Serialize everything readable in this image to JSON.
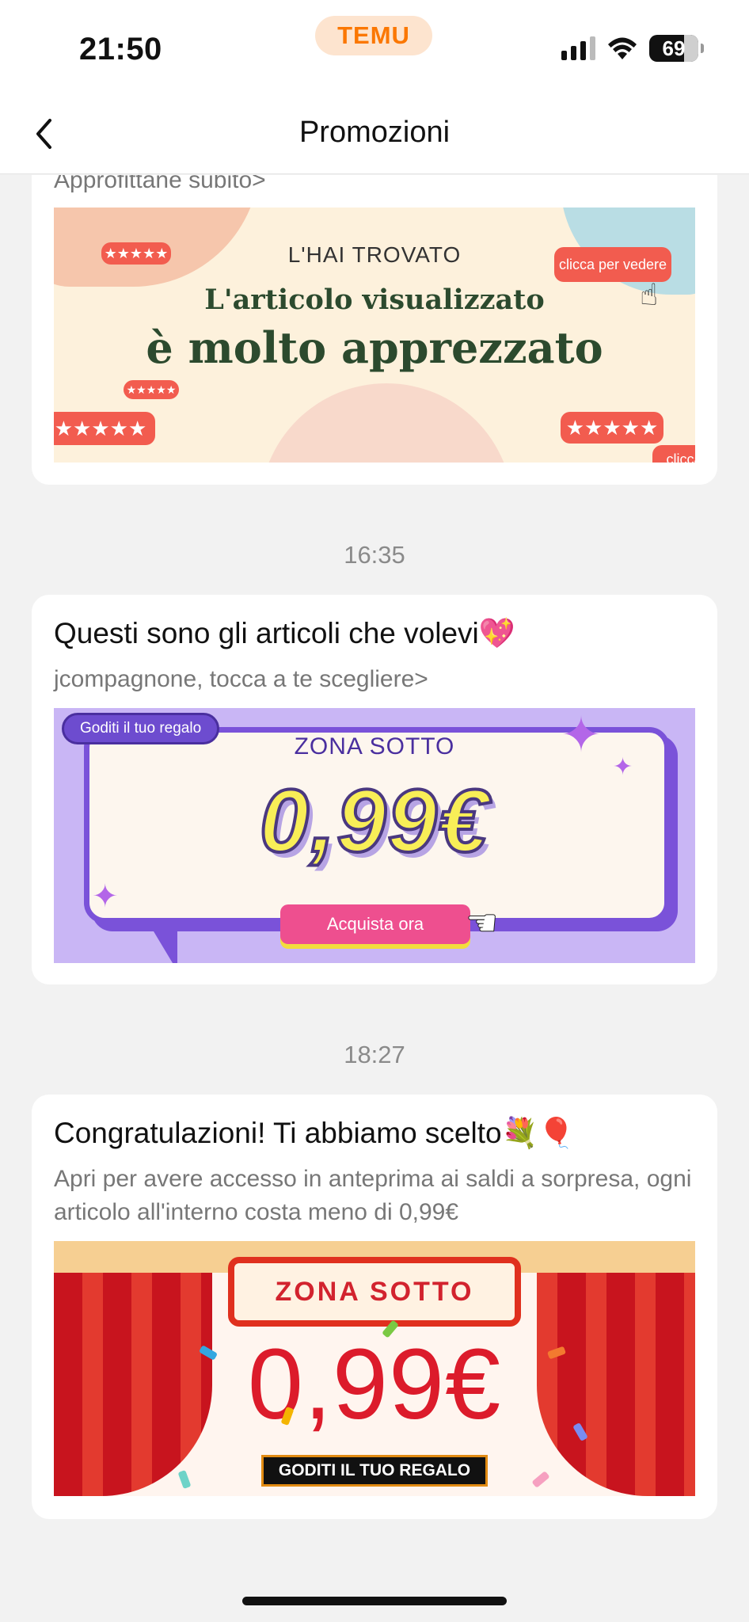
{
  "status_bar": {
    "time": "21:50",
    "app_badge": "TEMU",
    "battery": "69"
  },
  "nav": {
    "title": "Promozioni"
  },
  "messages": [
    {
      "subtitle": "Approfittane subito>",
      "banner": {
        "kicker": "L'HAI TROVATO",
        "line1": "L'articolo visualizzato",
        "line2": "è molto apprezzato",
        "bubble_text": "clicca per vedere",
        "bubble_text_short": "clicca",
        "stars": "★★★★★"
      }
    },
    {
      "timestamp": "16:35",
      "title": "Questi sono gli articoli che volevi💖",
      "subtitle": "jcompagnone, tocca a te scegliere>",
      "banner": {
        "pill": "Goditi il tuo regalo",
        "zone": "ZONA SOTTO",
        "price": "0,99€",
        "cta": "Acquista ora"
      }
    },
    {
      "timestamp": "18:27",
      "title": "Congratulazioni! Ti abbiamo scelto💐🎈",
      "subtitle": "Apri per avere accesso in anteprima ai saldi a sorpresa, ogni articolo all'interno costa meno di 0,99€",
      "banner": {
        "zone": "ZONA SOTTO",
        "price": "0,99€",
        "cta": "GODITI IL TUO REGALO"
      }
    }
  ],
  "colors": {
    "brand": "#fb7701",
    "background": "#f2f2f2",
    "card": "#ffffff"
  }
}
